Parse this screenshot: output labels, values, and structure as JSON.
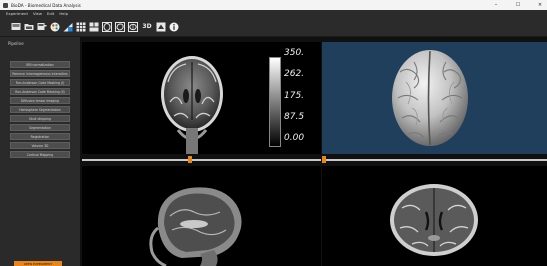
{
  "window": {
    "title": "BioDA - Biomedical Data Analysis",
    "minimize": "–",
    "maximize": "☐",
    "close": "×"
  },
  "menu": [
    "Experiment",
    "View",
    "Edit",
    "Help"
  ],
  "toolbar": {
    "three_d_label": "3D"
  },
  "sidebar": {
    "title": "Pipeline",
    "items": [
      "BRI normalization",
      "Remove inhomogeneous intensities",
      "Run-Anderson Code Masking (I)",
      "Run-Anderson Code Masking (II)",
      "Diffusion tensor imaging",
      "Hemisphere Segmentation",
      "Skull stripping",
      "Segmentation",
      "Registration",
      "Volume 3D",
      "Cortical Mapping"
    ],
    "bottom_button": "OPEN EXPERIMENT"
  },
  "colorbar": {
    "labels": [
      "350.",
      "262.",
      "175.",
      "87.5",
      "0.00"
    ]
  },
  "viewports": {
    "coronal": "coronal-mri",
    "render3d": "brain-3d-render",
    "sagittal": "sagittal-mri",
    "axial": "axial-mri"
  },
  "sliders": {
    "left_position": 0.45,
    "right_position": 0.0
  },
  "colors": {
    "accent": "#e8861e",
    "panel": "#2a2a2a",
    "render_bg": "#1f3f5c"
  }
}
